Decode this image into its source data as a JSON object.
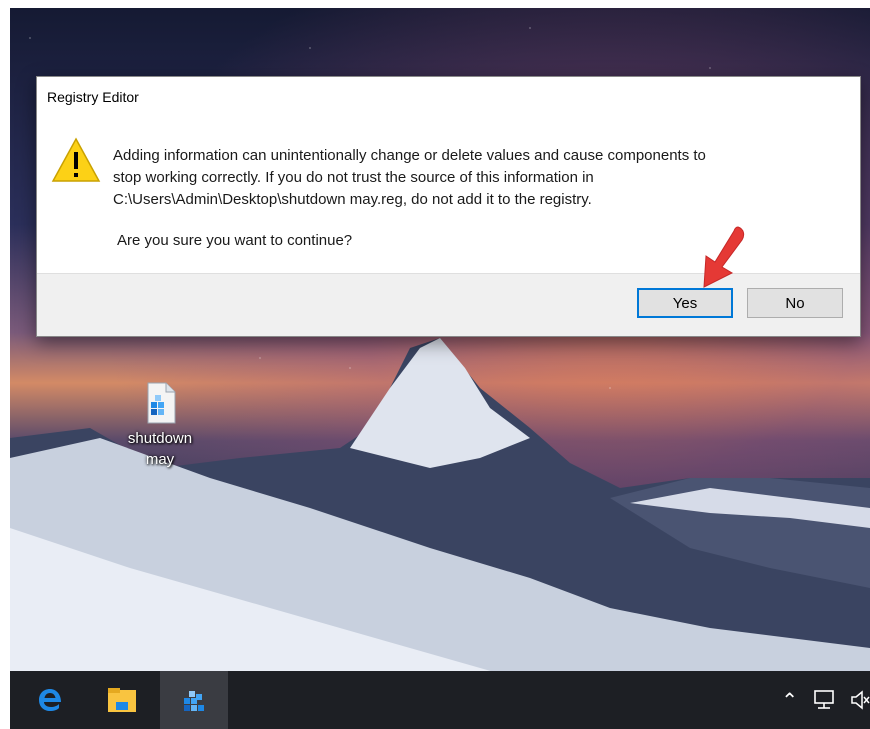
{
  "dialog": {
    "title": "Registry Editor",
    "message_lines": [
      "Adding information can unintentionally change or delete values and cause components to",
      "stop working correctly. If you do not trust the source of this information in",
      "C:\\Users\\Admin\\Desktop\\shutdown may.reg, do not add it to the registry."
    ],
    "question": "Are you sure you want to continue?",
    "yes_label": "Yes",
    "no_label": "No",
    "icon": "warning-icon"
  },
  "desktop": {
    "icon_label_line1": "shutdown",
    "icon_label_line2": "may",
    "icon": "registry-file-icon"
  },
  "taskbar": {
    "items": [
      "edge-icon",
      "file-explorer-icon",
      "registry-editor-icon"
    ],
    "tray": [
      "chevron-up-icon",
      "network-icon",
      "volume-muted-icon"
    ]
  },
  "colors": {
    "accent": "#0078d7",
    "taskbar": "#1d1f24",
    "warning_yellow": "#fcd116",
    "arrow_red": "#e53935"
  }
}
